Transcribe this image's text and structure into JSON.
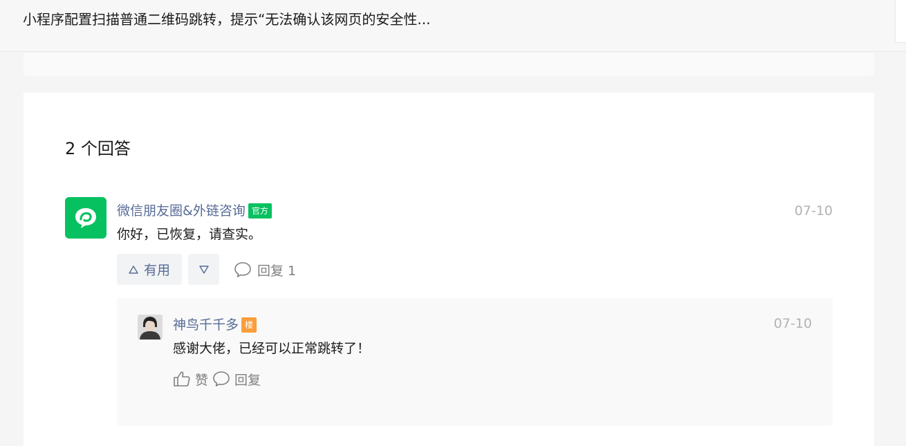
{
  "header": {
    "question_title": "小程序配置扫描普通二维码跳转，提示“无法确认该网页的安全性..."
  },
  "answers": {
    "count_label": "2 个回答",
    "items": [
      {
        "author": "微信朋友圈&外链咨询",
        "badge": "官方",
        "date": "07-10",
        "content": "你好，已恢复，请查实。",
        "useful_label": "有用",
        "useful_icon": "up-triangle-icon",
        "down_icon": "down-triangle-icon",
        "reply_label": "回复 1",
        "reply_icon": "comment-icon",
        "replies": [
          {
            "author": "神鸟千千多",
            "badge": "楼",
            "date": "07-10",
            "content": "感谢大佬，已经可以正常跳转了！",
            "like_label": "赞",
            "like_icon": "thumbs-up-icon",
            "reply_label": "回复",
            "reply_icon": "comment-icon"
          }
        ]
      }
    ]
  },
  "colors": {
    "official_green": "#07c160",
    "link_blue": "#576b95",
    "floor_orange": "#fa9d3b",
    "muted_gray": "#b2b2b2"
  }
}
